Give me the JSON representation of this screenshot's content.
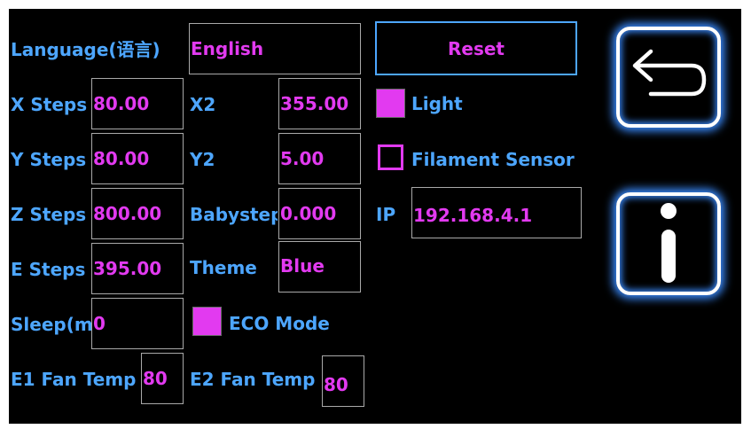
{
  "colors": {
    "label": "#4da6ff",
    "value": "#e23af0",
    "background": "#000000",
    "glow": "#3b8cff"
  },
  "settings": {
    "language": {
      "label": "Language(语言)",
      "value": "English"
    },
    "x_steps": {
      "label": "X Steps",
      "value": "80.00"
    },
    "y_steps": {
      "label": "Y Steps",
      "value": "80.00"
    },
    "z_steps": {
      "label": "Z Steps",
      "value": "800.00"
    },
    "e_steps": {
      "label": "E Steps",
      "value": "395.00"
    },
    "sleep": {
      "label": "Sleep(m",
      "value": "0"
    },
    "e1_fan_temp": {
      "label": "E1 Fan Temp",
      "value": "80"
    },
    "x2": {
      "label": "X2",
      "value": "355.00"
    },
    "y2": {
      "label": "Y2",
      "value": "5.00"
    },
    "babystep": {
      "label": "Babystep",
      "value": "0.000"
    },
    "theme": {
      "label": "Theme",
      "value": "Blue"
    },
    "eco_mode": {
      "label": "ECO Mode",
      "checked": true
    },
    "e2_fan_temp": {
      "label": "E2 Fan Temp",
      "value": "80"
    },
    "light": {
      "label": "Light",
      "checked": true
    },
    "filament_sensor": {
      "label": "Filament Sensor",
      "checked": false
    },
    "ip": {
      "label": "IP",
      "value": "192.168.4.1"
    }
  },
  "buttons": {
    "reset": {
      "label": "Reset"
    },
    "back": {
      "icon": "back-arrow-icon"
    },
    "info": {
      "icon": "info-icon"
    }
  }
}
